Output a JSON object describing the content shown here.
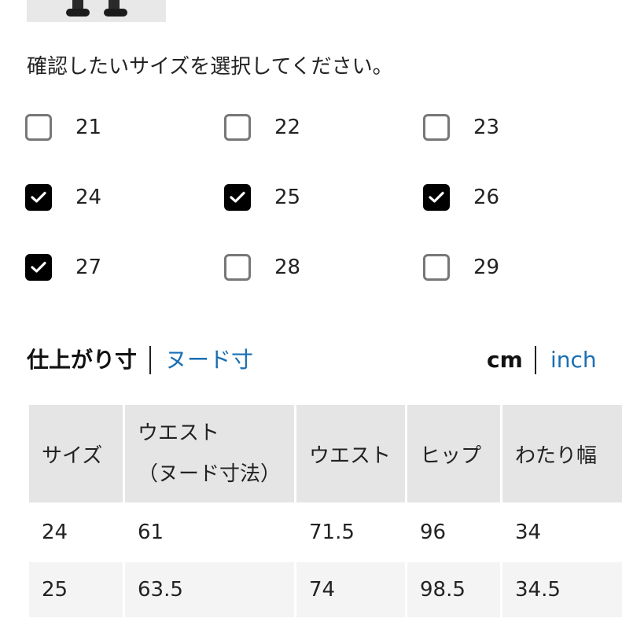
{
  "prompt": "確認したいサイズを選択してください。",
  "sizes": [
    {
      "label": "21",
      "checked": false
    },
    {
      "label": "22",
      "checked": false
    },
    {
      "label": "23",
      "checked": false
    },
    {
      "label": "24",
      "checked": true
    },
    {
      "label": "25",
      "checked": true
    },
    {
      "label": "26",
      "checked": true
    },
    {
      "label": "27",
      "checked": true
    },
    {
      "label": "28",
      "checked": false
    },
    {
      "label": "29",
      "checked": false
    }
  ],
  "measure_tabs": {
    "finished": "仕上がり寸",
    "body": "ヌード寸",
    "active": "finished"
  },
  "units": {
    "cm": "cm",
    "inch": "inch",
    "active": "cm"
  },
  "table": {
    "headers": {
      "size": "サイズ",
      "waist_body_line1": "ウエスト",
      "waist_body_line2": "（ヌード寸法）",
      "waist": "ウエスト",
      "hip": "ヒップ",
      "thigh": "わたり幅"
    },
    "rows": [
      [
        "24",
        "61",
        "71.5",
        "96",
        "34"
      ],
      [
        "25",
        "63.5",
        "74",
        "98.5",
        "34.5"
      ]
    ]
  },
  "colors": {
    "checked_fill": "#000000",
    "link_blue": "#1a6fb3",
    "header_gray": "#e5e5e5"
  }
}
